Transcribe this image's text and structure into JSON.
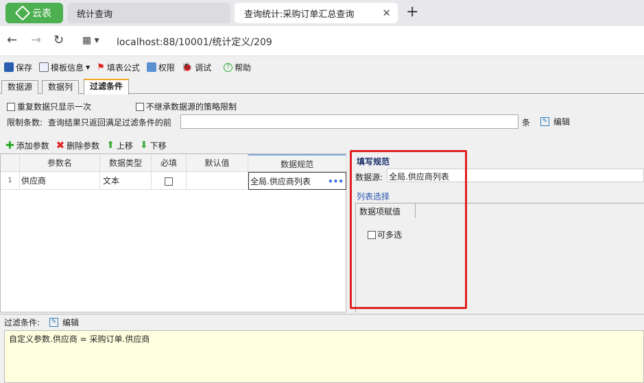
{
  "browser": {
    "app_button": "云表",
    "tabs": [
      {
        "label": "统计查询"
      },
      {
        "label": "查询统计:采购订单汇总查询"
      }
    ],
    "new_tab": "+",
    "close": "✕",
    "url": "localhost:88/10001/统计定义/209"
  },
  "toolbar": {
    "save": "保存",
    "template": "模板信息",
    "formula": "填表公式",
    "permission": "权限",
    "debug": "调试",
    "help": "帮助"
  },
  "page_tabs": [
    "数据源",
    "数据列",
    "过滤条件"
  ],
  "options": {
    "show_once": "重复数据只显示一次",
    "no_inherit": "不继承数据源的策略限制",
    "limit_label": "限制条数:",
    "limit_desc": "查询结果只返回满足过滤条件的前",
    "limit_value": "",
    "limit_unit": "条",
    "edit": "编辑"
  },
  "param_toolbar": {
    "add": "添加参数",
    "delete": "删除参数",
    "up": "上移",
    "down": "下移"
  },
  "grid": {
    "headers": [
      "参数名",
      "数据类型",
      "必填",
      "默认值",
      "数据规范"
    ],
    "rows": [
      {
        "index": "1",
        "name": "供应商",
        "type": "文本",
        "required": false,
        "default": "",
        "spec": "全局.供应商列表",
        "more": "•••"
      }
    ]
  },
  "panel": {
    "title": "填写规范",
    "datasource_label": "数据源:",
    "datasource_value": "全局.供应商列表",
    "list_select": "列表选择",
    "tab": "数据项赋值",
    "multi": "可多选"
  },
  "filter": {
    "label": "过滤条件:",
    "edit": "编辑",
    "expression": "自定义参数.供应商 = 采购订单.供应商"
  }
}
